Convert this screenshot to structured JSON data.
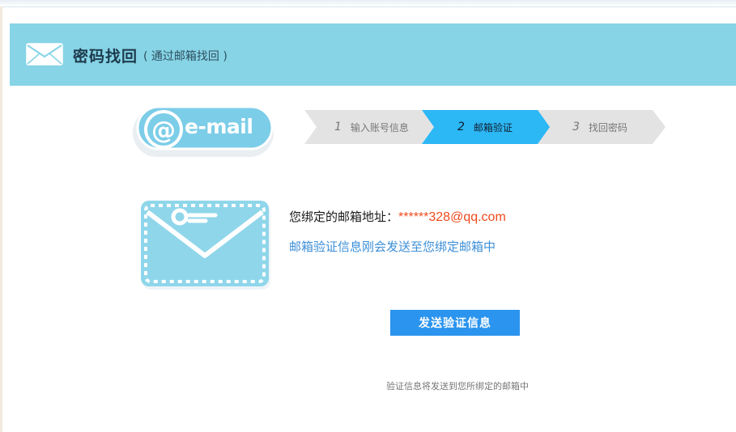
{
  "header": {
    "title": "密码找回",
    "subtitle": "( 通过邮箱找回 )"
  },
  "logo": {
    "text": "e-mail"
  },
  "steps": [
    {
      "num": "1",
      "label": "输入账号信息",
      "state": "done"
    },
    {
      "num": "2",
      "label": "邮箱验证",
      "state": "active"
    },
    {
      "num": "3",
      "label": "找回密码",
      "state": "pending"
    }
  ],
  "main": {
    "address_label": "您绑定的邮箱地址：",
    "address_value": "******328@qq.com",
    "info": "邮箱验证信息刚会发送至您绑定邮箱中",
    "send_button": "发送验证信息",
    "note": "验证信息将发送到您所绑定的邮箱中"
  },
  "colors": {
    "header_bg": "#86d4e6",
    "active_step": "#2cb7f5",
    "button": "#2b94ee",
    "email_text": "#f04a1c",
    "info_text": "#3d8fd8"
  }
}
